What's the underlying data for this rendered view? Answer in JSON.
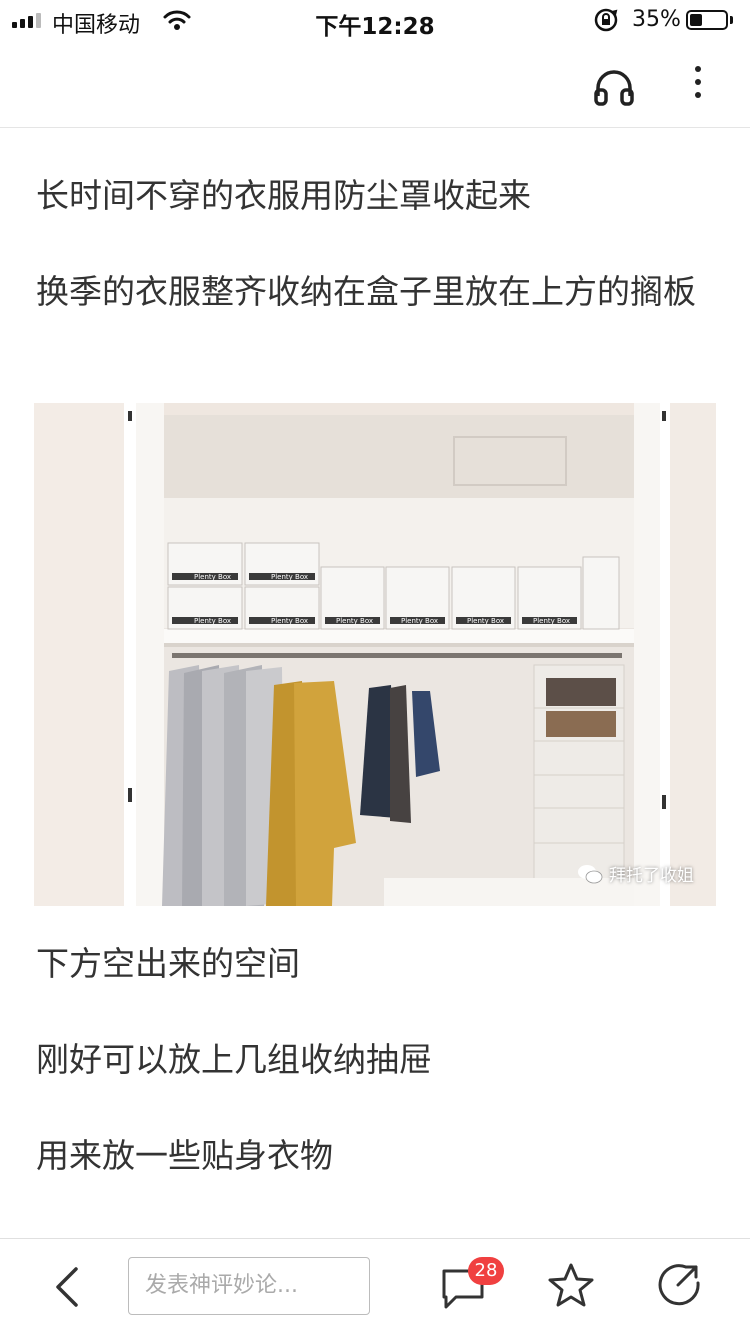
{
  "status_bar": {
    "carrier": "中国移动",
    "time": "下午12:28",
    "battery_percent": "35%",
    "battery_level": 0.35
  },
  "top_nav": {
    "icons": [
      "headphone-icon",
      "more-vertical-icon"
    ]
  },
  "article": {
    "paragraphs_before_image": [
      "长时间不穿的衣服用防尘罩收起来",
      "换季的衣服整齐收纳在盒子里放在上方的搁板"
    ],
    "image": {
      "box_label": "Plenty Box",
      "watermark": "拜托了收姐"
    },
    "paragraphs_after_image": [
      "下方空出来的空间",
      "刚好可以放上几组收纳抽屉",
      "用来放一些贴身衣物"
    ]
  },
  "bottom_bar": {
    "comment_placeholder": "发表神评妙论...",
    "comment_count": "28",
    "icons": [
      "back-arrow-icon",
      "comment-icon",
      "star-icon",
      "share-icon"
    ]
  },
  "colors": {
    "badge": "#f04040",
    "text": "#333333",
    "divider": "#e5e5e5"
  }
}
